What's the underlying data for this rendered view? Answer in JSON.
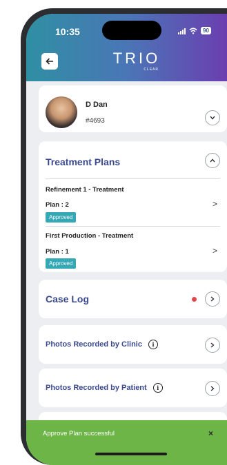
{
  "status_bar": {
    "time": "10:35",
    "battery": "90"
  },
  "header": {
    "logo_main": "TRIO",
    "logo_sub": "CLEAR"
  },
  "patient": {
    "name": "D Dan",
    "id": "#4693"
  },
  "treatment_plans": {
    "title": "Treatment Plans",
    "items": [
      {
        "name": "Refinement 1 - Treatment",
        "plan": "Plan : 2",
        "status": "Approved"
      },
      {
        "name": "First Production - Treatment",
        "plan": "Plan : 1",
        "status": "Approved"
      }
    ]
  },
  "case_log": {
    "title": "Case Log"
  },
  "photos_clinic": {
    "title": "Photos Recorded by Clinic"
  },
  "photos_patient": {
    "title": "Photos Recorded by Patient"
  },
  "toast": {
    "message": "Approve Plan successful",
    "close": "×"
  },
  "colors": {
    "accent": "#3b4a8e",
    "badge": "#34a8b5",
    "toast": "#6cb546",
    "alert_dot": "#e04848"
  }
}
